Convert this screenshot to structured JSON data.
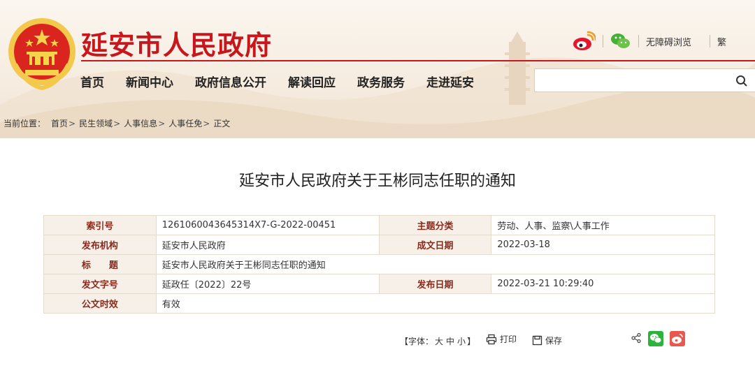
{
  "header": {
    "site_title": "延安市人民政府",
    "tools": {
      "accessibility": "无障碍浏览",
      "traditional": "繁"
    },
    "icons": [
      "national-emblem",
      "weibo-icon",
      "wechat-icon",
      "search-icon"
    ]
  },
  "nav": {
    "items": [
      "首页",
      "新闻中心",
      "政府信息公开",
      "解读回应",
      "政务服务",
      "走进延安"
    ]
  },
  "search": {
    "placeholder": "",
    "value": ""
  },
  "breadcrumb": {
    "prefix": "当前位置：",
    "items": [
      "首页",
      "民生领域",
      "人事信息",
      "人事任免",
      "正文"
    ],
    "separator": ">"
  },
  "article": {
    "title": "延安市人民政府关于王彬同志任职的通知",
    "meta": {
      "index_label": "索引号",
      "index_value": "1261060043645314X7-G-2022-00451",
      "topic_label": "主题分类",
      "topic_value": "劳动、人事、监察\\人事工作",
      "publisher_label": "发布机构",
      "publisher_value": "延安市人民政府",
      "created_label": "成文日期",
      "created_value": "2022-03-18",
      "title_label": "标　　题",
      "title_value": "延安市人民政府关于王彬同志任职的通知",
      "docno_label": "发文字号",
      "docno_value": "延政任〔2022〕22号",
      "published_label": "发布日期",
      "published_value": "2022-03-21 10:29:40",
      "validity_label": "公文时效",
      "validity_value": "有效"
    }
  },
  "article_tools": {
    "font_prefix": "【字体：",
    "font_large": "大",
    "font_medium": "中",
    "font_small": "小",
    "font_suffix": "】",
    "print": "打印",
    "save": "保存"
  },
  "colors": {
    "brand_red": "#c8161d",
    "label_red": "#8a2a1c",
    "header_bg": "#f6ece0",
    "wechat_green": "#2cb33b",
    "weibo_red": "#e8584d"
  }
}
